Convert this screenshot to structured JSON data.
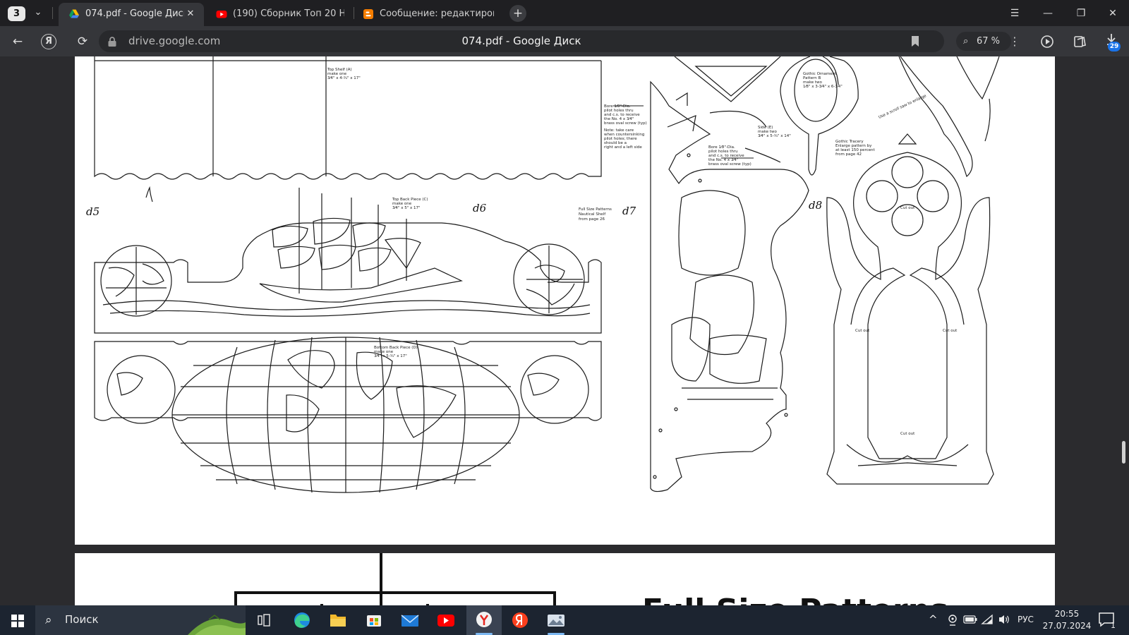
{
  "browser": {
    "tab_counter": "3",
    "tabs": [
      {
        "label": "074.pdf - Google Диск",
        "icon": "google-drive-icon",
        "active": true
      },
      {
        "label": "(190) Сборник Топ 20 Ном",
        "icon": "youtube-icon",
        "active": false
      },
      {
        "label": "Сообщение: редактиров",
        "icon": "blogger-icon",
        "active": false
      }
    ],
    "address": {
      "domain": "drive.google.com",
      "page_title": "074.pdf - Google Диск"
    },
    "zoom": "67 %",
    "downloads_badge": "29"
  },
  "pdf": {
    "page1": {
      "handwritten_labels": [
        "d5",
        "d6",
        "d7",
        "d8"
      ],
      "callouts": {
        "top_shelf": [
          "Top Shelf (A)",
          "make one",
          "3⁄4\" x 4-¾\" x 17\""
        ],
        "top_back": [
          "Top Back Piece (C)",
          "make one",
          "3⁄4\" x 5\" x 17\""
        ],
        "bottom_back": [
          "Bottom Back Piece (D)",
          "make one",
          "3⁄4\" x 5-¾\" x 17\""
        ],
        "nautical": [
          "Full Size Patterns",
          "Nautical Shelf",
          "from page 26"
        ],
        "bore_left": [
          "Bore 1⁄8\"-Dia.",
          "pilot holes thru",
          "and c.s. to receive",
          "the No. 4 x 3⁄4\"",
          "brass oval screw (typ)"
        ],
        "note": [
          "Note: take care",
          "when countersinking",
          "pilot holes; there",
          "should be a",
          "right and a left side"
        ],
        "side": [
          "Side (E)",
          "make two",
          "3⁄4\" x 5-¾\" x 14\""
        ],
        "bore_mid": [
          "Bore 1⁄8\"-Dia.",
          "pilot holes thru",
          "and c.s. to receive",
          "the No. 4 x 3⁄4\"",
          "brass oval screw (typ)"
        ],
        "gothic_mirror": [
          "Gothic Ornament",
          "Pattern B",
          "make two",
          "1⁄8\" x 3-3⁄4\" x 6-3⁄4\""
        ],
        "gothic_tracery": [
          "Gothic Tracery",
          "Enlarge pattern by",
          "at least 150 percent",
          "from page 42"
        ],
        "rotated_note": "Use a scroll saw to enlarge",
        "cut_out": "Cut out"
      }
    },
    "page2": {
      "heading": "Full Size Patterns"
    }
  },
  "taskbar": {
    "search_label": "Поиск",
    "apps": [
      "task-view-icon",
      "edge-icon",
      "file-explorer-icon",
      "store-icon",
      "mail-icon",
      "youtube-icon",
      "yandex-browser-icon",
      "yandex-icon",
      "photos-icon"
    ],
    "tray": {
      "language": "РУС",
      "time": "20:55",
      "date": "27.07.2024",
      "notifications": "1"
    }
  },
  "colors": {
    "tabstrip": "#1f1f22",
    "toolbar": "#35363a",
    "taskbar": "#1c2430",
    "accent": "#1a73e8"
  }
}
